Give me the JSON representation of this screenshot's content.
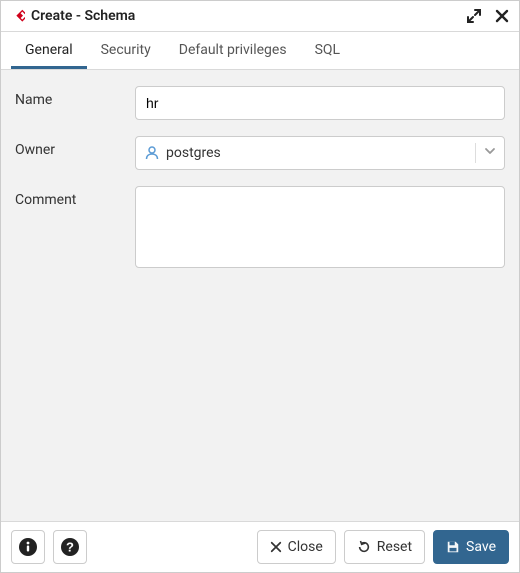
{
  "header": {
    "title": "Create - Schema"
  },
  "tabs": [
    {
      "label": "General",
      "active": true
    },
    {
      "label": "Security",
      "active": false
    },
    {
      "label": "Default privileges",
      "active": false
    },
    {
      "label": "SQL",
      "active": false
    }
  ],
  "form": {
    "name_label": "Name",
    "name_value": "hr",
    "owner_label": "Owner",
    "owner_value": "postgres",
    "comment_label": "Comment",
    "comment_value": ""
  },
  "footer": {
    "close_label": "Close",
    "reset_label": "Reset",
    "save_label": "Save"
  }
}
